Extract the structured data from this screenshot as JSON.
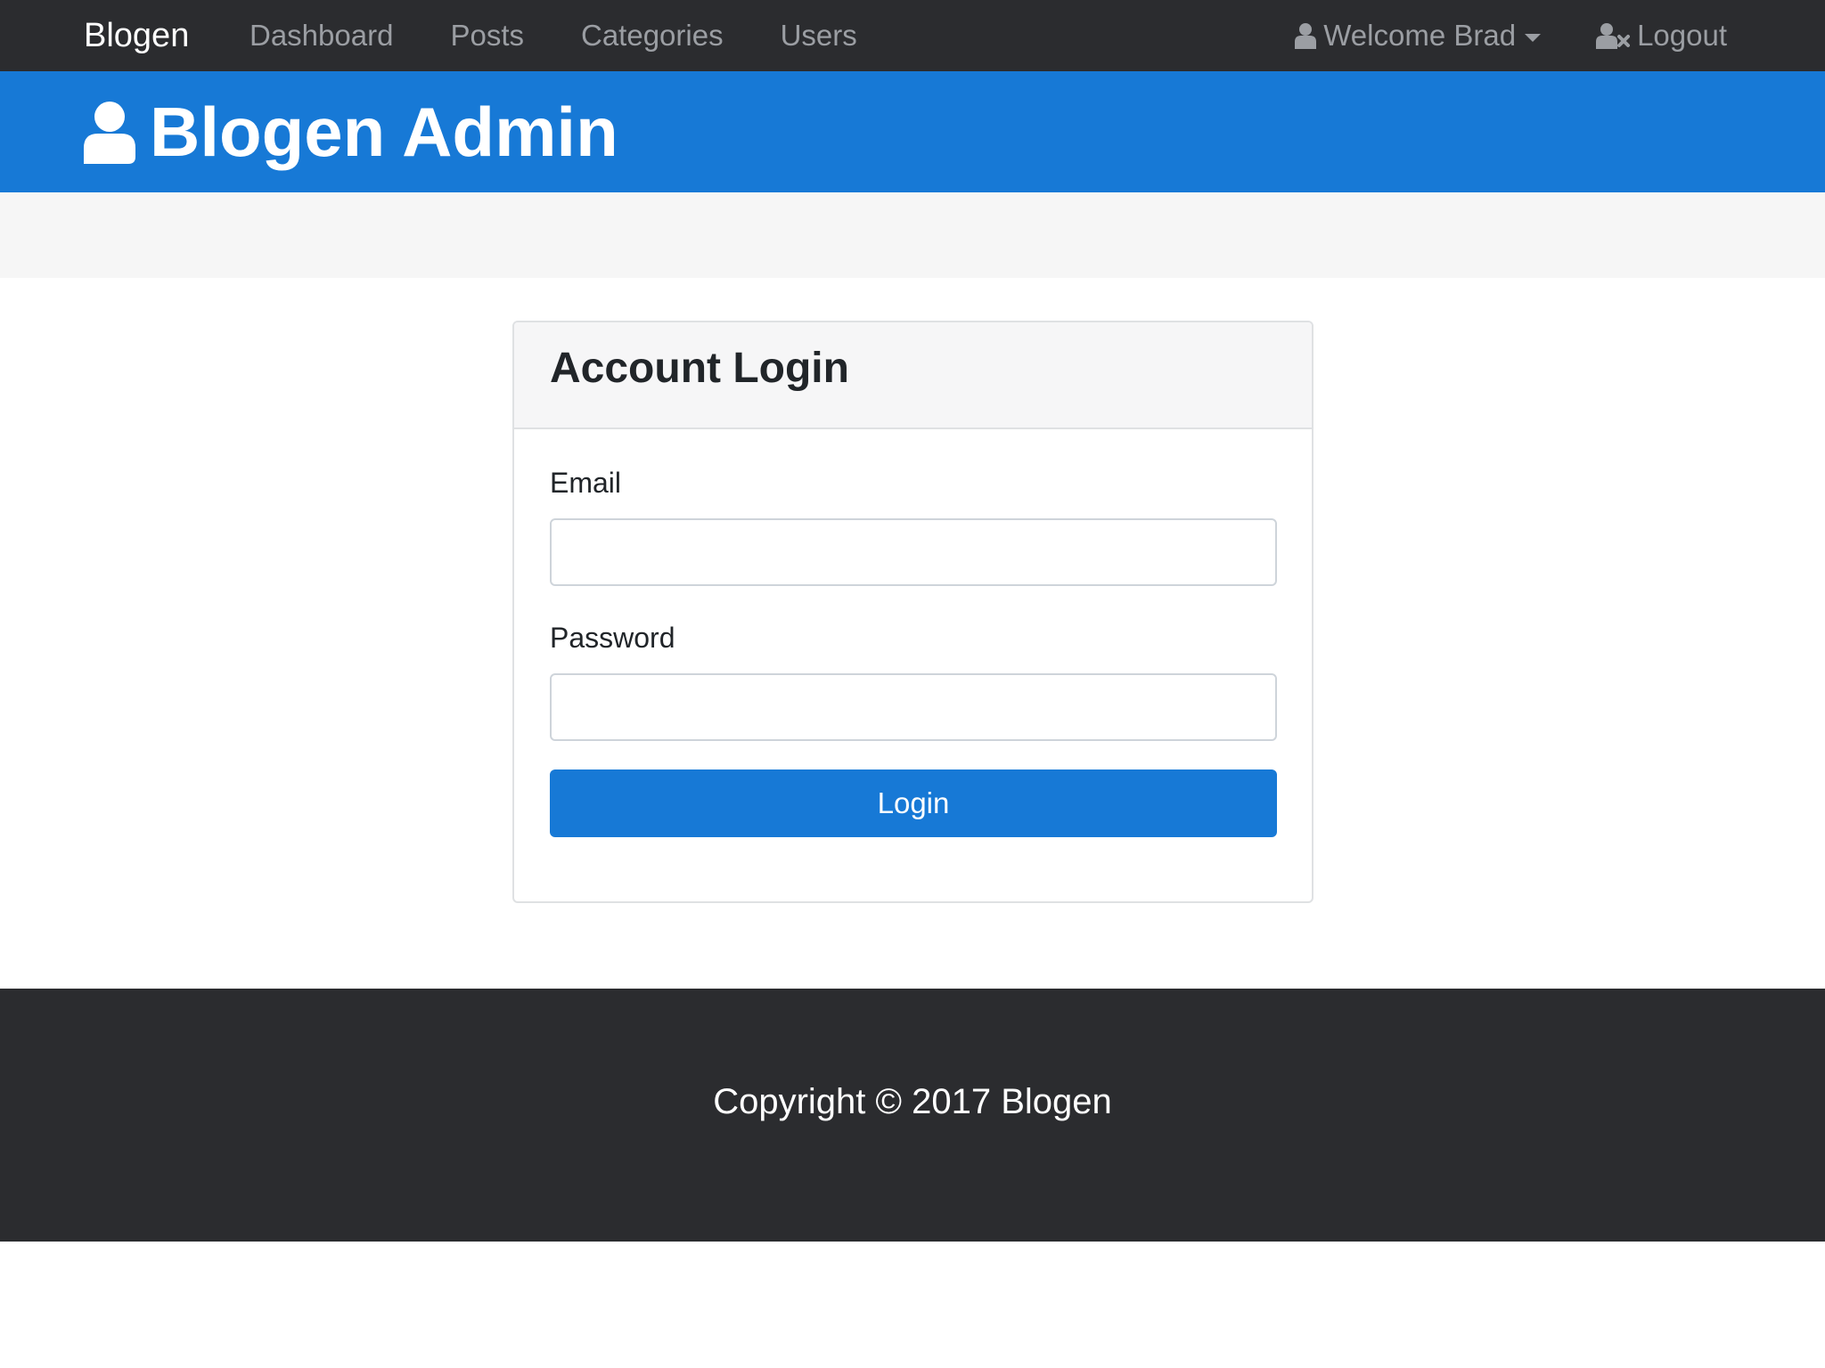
{
  "navbar": {
    "brand": "Blogen",
    "links": [
      {
        "label": "Dashboard"
      },
      {
        "label": "Posts"
      },
      {
        "label": "Categories"
      },
      {
        "label": "Users"
      }
    ],
    "welcome_label": "Welcome Brad",
    "logout_label": "Logout",
    "welcome_icon": "user-icon",
    "logout_icon": "user-times-icon"
  },
  "header": {
    "title": "Blogen Admin",
    "icon": "user-icon"
  },
  "login_card": {
    "title": "Account Login",
    "email_label": "Email",
    "email_value": "",
    "password_label": "Password",
    "password_value": "",
    "submit_label": "Login"
  },
  "footer": {
    "copyright": "Copyright © 2017 Blogen"
  },
  "colors": {
    "navbar_bg": "#2b2c2f",
    "primary": "#1779d6",
    "strip_bg": "#f6f6f6"
  }
}
